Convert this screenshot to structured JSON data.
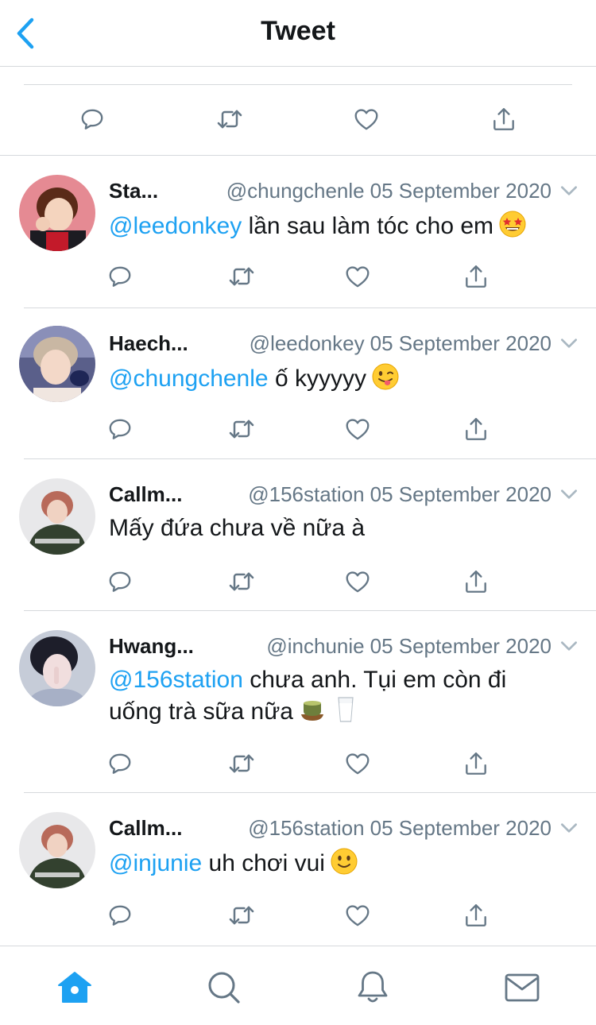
{
  "header": {
    "title": "Tweet"
  },
  "replies": [
    {
      "name": "Sta...",
      "handle": "@chungchenle",
      "date": "05 September 2020",
      "mention": "@leedonkey",
      "body": " lần sau làm tóc cho em",
      "body2": "",
      "emoji": "star-struck-emoji"
    },
    {
      "name": "Haech...",
      "handle": "@leedonkey",
      "date": "05 September 2020",
      "mention": "@chungchenle",
      "body": " ố kyyyyy",
      "body2": "",
      "emoji": "winking-tongue-emoji"
    },
    {
      "name": "Callm...",
      "handle": "@156station",
      "date": "05 September 2020",
      "mention": "",
      "body": "Mấy đứa chưa về nữa à",
      "body2": "",
      "emoji": ""
    },
    {
      "name": "Hwang...",
      "handle": "@inchunie",
      "date": "05 September 2020",
      "mention": "@156station",
      "body": " chưa anh. Tụi em còn đi",
      "body2": "uống trà sữa nữa",
      "emoji": "tea-and-milk-emoji"
    },
    {
      "name": "Callm...",
      "handle": "@156station",
      "date": "05 September 2020",
      "mention": "@injunie",
      "body": " uh chơi vui",
      "body2": "",
      "emoji": "slightly-smiling-emoji"
    }
  ],
  "colors": {
    "accent": "#1da1f2",
    "text": "#14171a",
    "secondary": "#657786",
    "divider": "#d6d9dc"
  },
  "icons": [
    "back-chevron-icon",
    "reply-icon",
    "retweet-icon",
    "like-icon",
    "share-icon",
    "home-icon",
    "search-icon",
    "bell-icon",
    "mail-icon"
  ]
}
